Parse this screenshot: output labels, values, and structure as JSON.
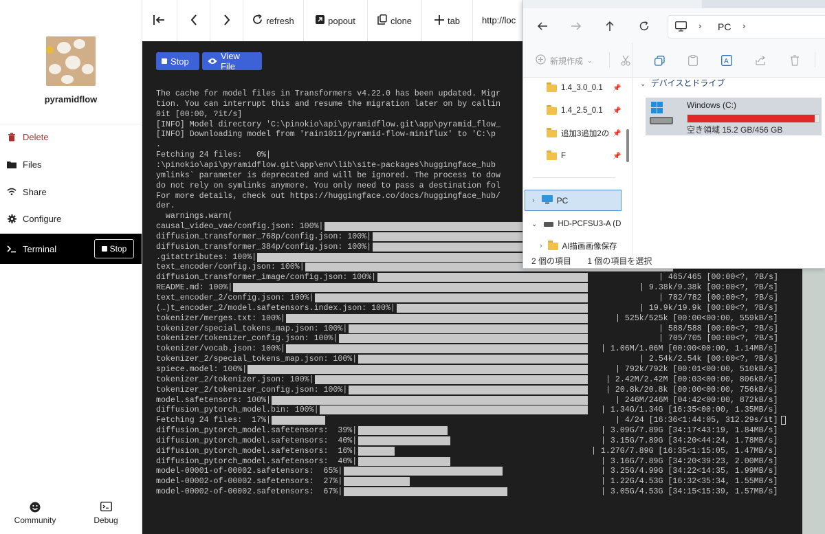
{
  "sidebar": {
    "app_name": "pyramidflow",
    "items": [
      {
        "label": "Delete",
        "icon": "trash-icon"
      },
      {
        "label": "Files",
        "icon": "folder-icon"
      },
      {
        "label": "Share",
        "icon": "wifi-icon"
      },
      {
        "label": "Configure",
        "icon": "gear-icon"
      }
    ],
    "terminal": {
      "label": "Terminal",
      "stop_label": "Stop"
    },
    "bottom": [
      {
        "label": "Community",
        "icon": "smiley-icon"
      },
      {
        "label": "Debug",
        "icon": "terminal-icon"
      }
    ]
  },
  "toolbar": {
    "refresh": "refresh",
    "popout": "popout",
    "clone": "clone",
    "tab": "tab",
    "url": "http://loc"
  },
  "terminal": {
    "stop_label": "Stop",
    "view_file_label": "View File",
    "lines": [
      "The cache for model files in Transformers v4.22.0 has been updated. Migr",
      "tion. You can interrupt this and resume the migration later on by callin",
      "0it [00:00, ?it/s]",
      "[INFO] Model directory 'C:\\pinokio\\api\\pyramidflow.git\\app\\pyramid_flow_",
      "[INFO] Downloading model from 'rain1011/pyramid-flow-miniflux' to 'C:\\p",
      ".",
      "Fetching 24 files:   0%|",
      ":\\pinokio\\api\\pyramidflow.git\\app\\env\\lib\\site-packages\\huggingface_hub",
      "ymlinks` parameter is deprecated and will be ignored. The process to dow",
      "do not rely on symlinks anymore. You only need to pass a destination fol",
      "For more details, check out https://huggingface.co/docs/huggingface_hub/",
      "der.",
      "  warnings.warn("
    ],
    "progress": [
      {
        "label": "causal_video_vae/config.json: 100%|",
        "value": 100,
        "stat": ""
      },
      {
        "label": "diffusion_transformer_768p/config.json: 100%|",
        "value": 100,
        "stat": ""
      },
      {
        "label": "diffusion_transformer_384p/config.json: 100%|",
        "value": 100,
        "stat": ""
      },
      {
        "label": ".gitattributes: 100%|",
        "value": 100,
        "stat": ""
      },
      {
        "label": "text_encoder/config.json: 100%|",
        "value": 100,
        "stat": ""
      },
      {
        "label": "diffusion_transformer_image/config.json: 100%|",
        "value": 100,
        "stat": "| 465/465 [00:00<?, ?B/s]"
      },
      {
        "label": "README.md: 100%|",
        "value": 100,
        "stat": "| 9.38k/9.38k [00:00<?, ?B/s]"
      },
      {
        "label": "text_encoder_2/config.json: 100%|",
        "value": 100,
        "stat": "| 782/782 [00:00<?, ?B/s]"
      },
      {
        "label": "(…)t_encoder_2/model.safetensors.index.json: 100%|",
        "value": 100,
        "stat": "| 19.9k/19.9k [00:00<?, ?B/s]"
      },
      {
        "label": "tokenizer/merges.txt: 100%|",
        "value": 100,
        "stat": "| 525k/525k [00:00<00:00, 559kB/s]"
      },
      {
        "label": "tokenizer/special_tokens_map.json: 100%|",
        "value": 100,
        "stat": "| 588/588 [00:00<?, ?B/s]"
      },
      {
        "label": "tokenizer/tokenizer_config.json: 100%|",
        "value": 100,
        "stat": "| 705/705 [00:00<?, ?B/s]"
      },
      {
        "label": "tokenizer/vocab.json: 100%|",
        "value": 100,
        "stat": "| 1.06M/1.06M [00:00<00:00, 1.14MB/s]"
      },
      {
        "label": "tokenizer_2/special_tokens_map.json: 100%|",
        "value": 100,
        "stat": "| 2.54k/2.54k [00:00<?, ?B/s]"
      },
      {
        "label": "spiece.model: 100%|",
        "value": 100,
        "stat": "| 792k/792k [00:01<00:00, 510kB/s]"
      },
      {
        "label": "tokenizer_2/tokenizer.json: 100%|",
        "value": 100,
        "stat": "| 2.42M/2.42M [00:03<00:00, 806kB/s]"
      },
      {
        "label": "tokenizer_2/tokenizer_config.json: 100%|",
        "value": 100,
        "stat": "| 20.8k/20.8k [00:00<00:00, 756kB/s]"
      },
      {
        "label": "model.safetensors: 100%|",
        "value": 100,
        "stat": "| 246M/246M [04:42<00:00, 872kB/s]"
      },
      {
        "label": "diffusion_pytorch_model.bin: 100%|",
        "value": 100,
        "stat": "| 1.34G/1.34G [16:35<00:00, 1.35MB/s]"
      },
      {
        "label": "Fetching 24 files:  17%|",
        "value": 17,
        "stat": "| 4/24 [16:36<1:44:05, 312.29s/it]"
      },
      {
        "label": "diffusion_pytorch_model.safetensors:  39%|",
        "value": 39,
        "stat": "| 3.09G/7.89G [34:17<43:19, 1.84MB/s]"
      },
      {
        "label": "diffusion_pytorch_model.safetensors:  40%|",
        "value": 40,
        "stat": "| 3.15G/7.89G [34:20<44:24, 1.78MB/s]"
      },
      {
        "label": "diffusion_pytorch_model.safetensors:  16%|",
        "value": 16,
        "stat": "| 1.27G/7.89G [16:35<1:15:05, 1.47MB/s]"
      },
      {
        "label": "diffusion_pytorch_model.safetensors:  40%|",
        "value": 40,
        "stat": "| 3.16G/7.89G [34:20<39:23, 2.00MB/s]"
      },
      {
        "label": "model-00001-of-00002.safetensors:  65%|",
        "value": 65,
        "stat": "| 3.25G/4.99G [34:22<14:35, 1.99MB/s]"
      },
      {
        "label": "model-00002-of-00002.safetensors:  27%|",
        "value": 27,
        "stat": "| 1.22G/4.53G [16:32<35:34, 1.55MB/s]"
      },
      {
        "label": "model-00002-of-00002.safetensors:  67%|",
        "value": 67,
        "stat": "| 3.05G/4.53G [34:15<15:39, 1.57MB/s]"
      }
    ]
  },
  "explorer": {
    "address": "PC",
    "new_label": "新規作成",
    "quick_access": [
      {
        "label": "1.4_3.0_0.1"
      },
      {
        "label": "1.4_2.5_0.1"
      },
      {
        "label": "追加3追加2の"
      },
      {
        "label": "F"
      }
    ],
    "pc_label": "PC",
    "drive_label_tree": "HD-PCFSU3-A (D",
    "subfolder": "AI描画画像保存",
    "section_title": "デバイスとドライブ",
    "drive": {
      "name": "Windows (C:)",
      "free": "空き領域 15.2 GB/456 GB",
      "used_fraction": 0.967
    },
    "status_items": "2 個の項目",
    "status_selected": "1 個の項目を選択"
  },
  "colors": {
    "accent": "#3d62d8",
    "terminal_bg": "#1e1e1e",
    "danger": "#b03030",
    "drive_bar": "#e02828"
  }
}
